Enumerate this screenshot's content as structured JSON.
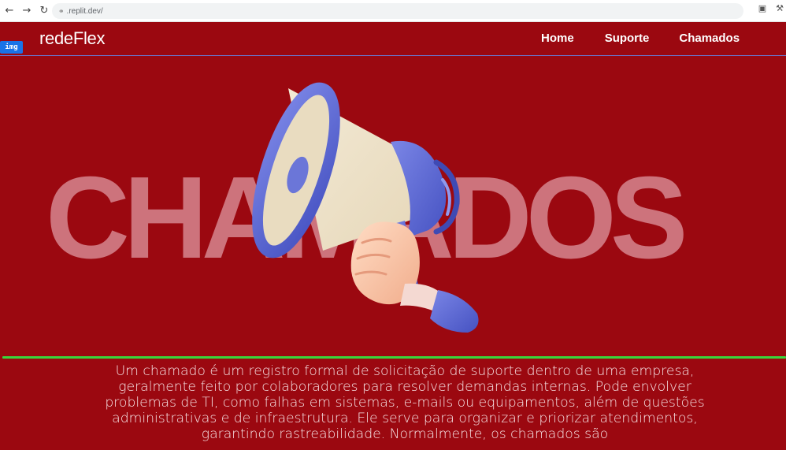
{
  "browser": {
    "url": ".replit.dev/",
    "icons": [
      "back-icon",
      "forward-icon",
      "reload-icon",
      "lock-icon",
      "cast-icon",
      "extensions-icon"
    ]
  },
  "nav": {
    "brand": "redeFlex",
    "links": [
      "Home",
      "Suporte",
      "Chamados"
    ]
  },
  "badge": "img",
  "hero": {
    "word": "CHAMADOS"
  },
  "description": "Um chamado é um registro formal de solicitação de suporte dentro de uma empresa, geralmente feito por colaboradores para resolver demandas internas. Pode envolver problemas de TI, como falhas em sistemas, e-mails ou equipamentos, além de questões administrativas e de infraestrutura. Ele serve para organizar e priorizar atendimentos, garantindo rastreabilidade. Normalmente, os chamados são",
  "colors": {
    "page_background": "#9b0810",
    "divider": "#39d63b",
    "nav_underline": "#6a73c9",
    "badge": "#1a73e8"
  }
}
